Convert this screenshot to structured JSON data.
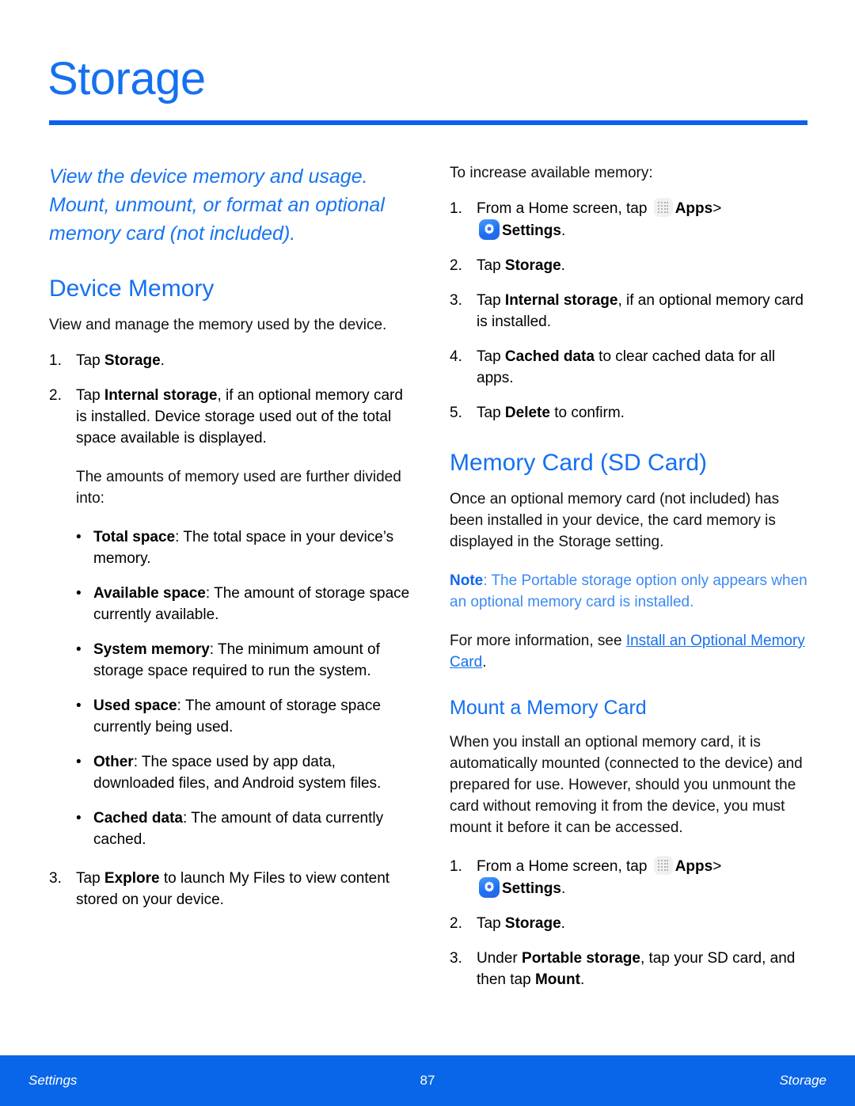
{
  "page": {
    "title": "Storage",
    "accent_color": "#1570F0",
    "rule_color": "#0A62EE",
    "note_color": "#3C8AF5",
    "footer_color": "#0A66E8"
  },
  "lead": "View the device memory and usage. Mount, unmount, or format an optional memory card (not included).",
  "left_column": {
    "section_title": "Device Memory",
    "intro": "View and manage the memory used by the device.",
    "steps": [
      {
        "num": "1.",
        "prefix": "Tap ",
        "bold": "Storage",
        "suffix": "."
      },
      {
        "num": "2.",
        "prefix": "Tap ",
        "bold": "Internal storage",
        "suffix": ", if an optional memory card is installed. Device storage used out of the total space available is displayed."
      }
    ],
    "divided_intro": "The amounts of memory used are further divided into:",
    "bullets": [
      {
        "term": "Total space",
        "desc": ": The total space in your device’s memory."
      },
      {
        "term": "Available space",
        "desc": ": The amount of storage space currently available."
      },
      {
        "term": "System memory",
        "desc": ": The minimum amount of storage space required to run the system."
      },
      {
        "term": "Used space",
        "desc": ": The amount of storage space currently being used."
      },
      {
        "term": "Other",
        "desc": ": The space used by app data, downloaded files, and Android system files."
      },
      {
        "term": "Cached data",
        "desc": ": The amount of data currently cached."
      }
    ],
    "step3": {
      "num": "3.",
      "prefix": "Tap ",
      "bold": "Explore",
      "suffix": " to launch My Files to view content stored on your device."
    }
  },
  "right_column": {
    "increase_intro": "To increase available memory:",
    "increase_steps": {
      "s1": {
        "num": "1.",
        "text_before_apps": "From a Home screen, tap ",
        "apps_label": "Apps",
        "chevron": ">",
        "settings_label": "Settings",
        "settings_suffix": "."
      },
      "s2": {
        "num": "2.",
        "prefix": "Tap ",
        "bold": "Storage",
        "suffix": "."
      },
      "s3": {
        "num": "3.",
        "prefix": "Tap ",
        "bold": "Internal storage",
        "suffix": ", if an optional memory card is installed."
      },
      "s4": {
        "num": "4.",
        "prefix": "Tap ",
        "bold": "Cached data",
        "suffix": " to clear cached data for all apps."
      },
      "s5": {
        "num": "5.",
        "prefix": "Tap ",
        "bold": "Delete",
        "suffix": " to confirm."
      }
    },
    "sd_section_title": "Memory Card (SD Card)",
    "sd_intro": "Once an optional memory card (not included) has been installed in your device, the card memory is displayed in the Storage setting.",
    "note": {
      "label": "Note",
      "text": ": The Portable storage option only appears when an optional memory card is installed."
    },
    "more_info": {
      "prefix": "For more information, see ",
      "link": "Install an Optional Memory Card",
      "suffix": "."
    },
    "mount_title": "Mount a Memory Card",
    "mount_body": "When you install an optional memory card, it is automatically mounted (connected to the device) and prepared for use. However, should you unmount the card without removing it from the device, you must mount it before it can be accessed.",
    "mount_steps": {
      "m1": {
        "num": "1.",
        "text_before_apps": "From a Home screen, tap ",
        "apps_label": "Apps",
        "chevron": ">",
        "settings_label": "Settings",
        "settings_suffix": "."
      },
      "m2": {
        "num": "2.",
        "prefix": "Tap ",
        "bold": "Storage",
        "suffix": "."
      },
      "m3": {
        "num": "3.",
        "prefix": "Under ",
        "bold": "Portable storage",
        "mid": ", tap your SD card, and then tap ",
        "bold2": "Mount",
        "suffix": "."
      }
    }
  },
  "footer": {
    "left": "Settings",
    "page_number": "87",
    "right": "Storage"
  }
}
